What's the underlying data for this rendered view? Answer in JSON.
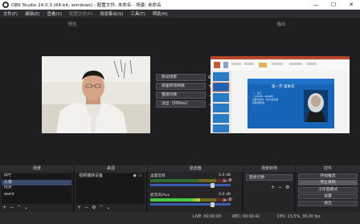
{
  "window": {
    "title": "OBS Studio 24.0.3 (64-bit, windows) - 配置文件: 未命名 - 场景: 未命名",
    "min_glyph": "—",
    "max_glyph": "☐",
    "close_glyph": "✕"
  },
  "menu": [
    "文件(F)",
    "编辑(E)",
    "查看(V)",
    "配置文件(P)",
    "场景集合(S)",
    "工具(T)",
    "帮助(H)"
  ],
  "preview": {
    "title": "预览"
  },
  "program": {
    "title": "输出",
    "slide": {
      "heading": "第一节  叔本华",
      "lines": [
        "一、生平",
        "（1788年—1860年）",
        "主要代表作：《作为意志和",
        "表象的世界》"
      ]
    }
  },
  "transitions": {
    "studio_button": "移动场景",
    "quick_button": "快速转场转换",
    "cut_button": "直接切换",
    "fade_button": "淡出（300ms）",
    "gear_glyph": "⚙",
    "add_glyph": "+",
    "chevron_glyph": "⌄"
  },
  "docks": {
    "scenes": {
      "title": "场景",
      "items": [
        "PPT",
        "头像",
        "PDF",
        "word"
      ],
      "selected_index": 1
    },
    "sources": {
      "title": "来源",
      "items": [
        "视频捕获设备"
      ]
    },
    "mixer": {
      "title": "混音器",
      "channels": [
        {
          "name": "桌面音频",
          "db": "0.0 dB",
          "level": 0.0
        },
        {
          "name": "麦克风/Aux",
          "db": "0.0 dB",
          "level": 0.62
        }
      ]
    },
    "scene_transitions": {
      "title": "场景转场",
      "value": "直接切换"
    },
    "controls": {
      "title": "控件",
      "buttons": [
        "开始推流",
        "停止录制",
        "工作室模式",
        "设置",
        "退出"
      ],
      "active": [
        1
      ]
    }
  },
  "status": {
    "live": "LIVE: 00:00:00",
    "rec": "REC: 00:00:41",
    "cpu": "CPU: 15.5%, 30.00 fps"
  }
}
